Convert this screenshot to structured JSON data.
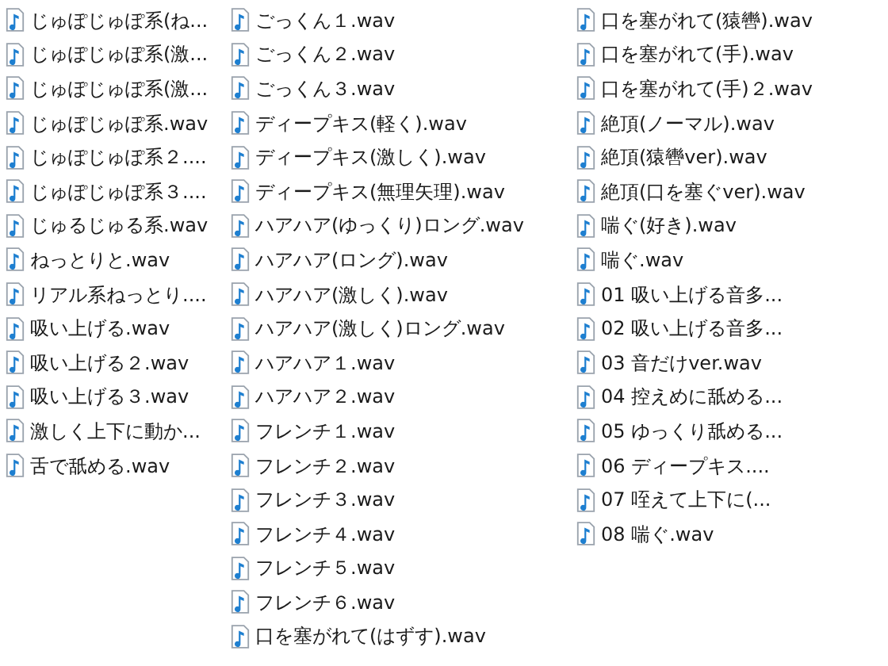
{
  "columns": [
    {
      "files": [
        "じゅぽじゅぽ系(ね...",
        "じゅぽじゅぽ系(激...",
        "じゅぽじゅぽ系(激...",
        "じゅぽじゅぽ系.wav",
        "じゅぽじゅぽ系２....",
        "じゅぽじゅぽ系３....",
        "じゅるじゅる系.wav",
        "ねっとりと.wav",
        "リアル系ねっとり....",
        "吸い上げる.wav",
        "吸い上げる２.wav",
        "吸い上げる３.wav",
        "激しく上下に動か...",
        "舌で舐める.wav"
      ]
    },
    {
      "files": [
        "ごっくん１.wav",
        "ごっくん２.wav",
        "ごっくん３.wav",
        "ディープキス(軽く).wav",
        "ディープキス(激しく).wav",
        "ディープキス(無理矢理).wav",
        "ハアハア(ゆっくり)ロング.wav",
        "ハアハア(ロング).wav",
        "ハアハア(激しく).wav",
        "ハアハア(激しく)ロング.wav",
        "ハアハア１.wav",
        "ハアハア２.wav",
        "フレンチ１.wav",
        "フレンチ２.wav",
        "フレンチ３.wav",
        "フレンチ４.wav",
        "フレンチ５.wav",
        "フレンチ６.wav",
        "口を塞がれて(はずす).wav"
      ]
    },
    {
      "files": [
        "口を塞がれて(猿轡).wav",
        "口を塞がれて(手).wav",
        "口を塞がれて(手)２.wav",
        "絶頂(ノーマル).wav",
        "絶頂(猿轡ver).wav",
        "絶頂(口を塞ぐver).wav",
        "喘ぐ(好き).wav",
        "喘ぐ.wav",
        "01 吸い上げる音多...",
        "02 吸い上げる音多...",
        "03 音だけver.wav",
        "04 控えめに舐める...",
        "05 ゆっくり舐める...",
        "06 ディープキス....",
        "07 咥えて上下に(...",
        "08 喘ぐ.wav"
      ]
    }
  ]
}
